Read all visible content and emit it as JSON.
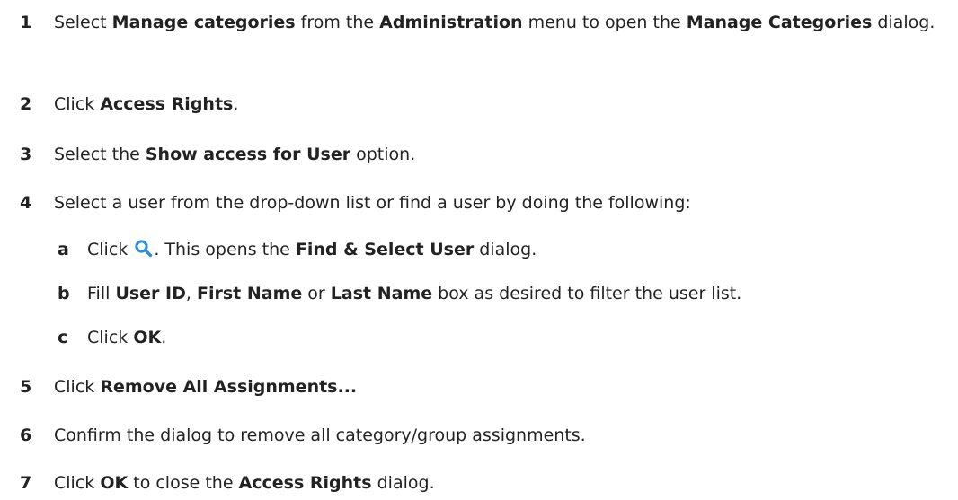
{
  "steps": [
    {
      "num": "1",
      "text_html": "Select <b>Manage categories</b> from the <b>Administration</b> menu to open the <b>Manage Categories</b> dialog."
    },
    {
      "num": "2",
      "text_html": "Click <b>Access Rights</b>."
    },
    {
      "num": "3",
      "text_html": "Select the <b>Show access for User</b> option."
    },
    {
      "num": "4",
      "text_html": "Select a user from the drop-down list or find a user by doing the following:"
    },
    {
      "num": "5",
      "text_html": "Click <b>Remove All Assignments...</b>"
    },
    {
      "num": "6",
      "text_html": "Confirm the dialog to remove all category/group assignments."
    },
    {
      "num": "7",
      "text_html": "Click <b>OK</b> to close the <b>Access Rights</b> dialog."
    }
  ],
  "substeps": [
    {
      "num": "a",
      "before": "Click",
      "icon": "search-icon",
      "after_html": ". This opens the <b>Find &amp; Select User</b> dialog."
    },
    {
      "num": "b",
      "text_html": "Fill <b>User ID</b>, <b>First Name</b> or <b>Last Name</b> box as desired to filter the user list."
    },
    {
      "num": "c",
      "text_html": "Click <b>OK</b>."
    }
  ],
  "colors": {
    "text": "#222222",
    "icon": "#2a8fd8"
  }
}
